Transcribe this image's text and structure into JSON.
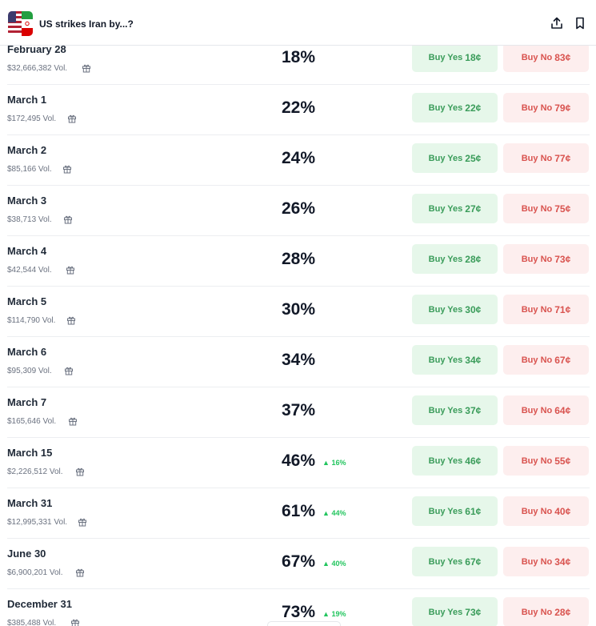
{
  "header": {
    "title": "US strikes Iran by...?",
    "share_icon": "share-icon",
    "bookmark_icon": "bookmark-icon"
  },
  "colors": {
    "yes_bg": "#e6f7ea",
    "yes_text": "#3a9c5a",
    "no_bg": "#fdeeee",
    "no_text": "#d9534f",
    "up": "#22c55e"
  },
  "labels": {
    "buy_yes": "Buy Yes",
    "buy_no": "Buy No"
  },
  "rows": [
    {
      "date": "February 28",
      "volume": "$32,666,382 Vol.",
      "chance": "18%",
      "change": "",
      "yes_price": "18¢",
      "no_price": "83¢"
    },
    {
      "date": "March 1",
      "volume": "$172,495 Vol.",
      "chance": "22%",
      "change": "",
      "yes_price": "22¢",
      "no_price": "79¢"
    },
    {
      "date": "March 2",
      "volume": "$85,166 Vol.",
      "chance": "24%",
      "change": "",
      "yes_price": "25¢",
      "no_price": "77¢"
    },
    {
      "date": "March 3",
      "volume": "$38,713 Vol.",
      "chance": "26%",
      "change": "",
      "yes_price": "27¢",
      "no_price": "75¢"
    },
    {
      "date": "March 4",
      "volume": "$42,544 Vol.",
      "chance": "28%",
      "change": "",
      "yes_price": "28¢",
      "no_price": "73¢"
    },
    {
      "date": "March 5",
      "volume": "$114,790 Vol.",
      "chance": "30%",
      "change": "",
      "yes_price": "30¢",
      "no_price": "71¢"
    },
    {
      "date": "March 6",
      "volume": "$95,309 Vol.",
      "chance": "34%",
      "change": "",
      "yes_price": "34¢",
      "no_price": "67¢"
    },
    {
      "date": "March 7",
      "volume": "$165,646 Vol.",
      "chance": "37%",
      "change": "",
      "yes_price": "37¢",
      "no_price": "64¢"
    },
    {
      "date": "March 15",
      "volume": "$2,226,512 Vol.",
      "chance": "46%",
      "change": "16%",
      "yes_price": "46¢",
      "no_price": "55¢"
    },
    {
      "date": "March 31",
      "volume": "$12,995,331 Vol.",
      "chance": "61%",
      "change": "44%",
      "yes_price": "61¢",
      "no_price": "40¢"
    },
    {
      "date": "June 30",
      "volume": "$6,900,201 Vol.",
      "chance": "67%",
      "change": "40%",
      "yes_price": "67¢",
      "no_price": "34¢"
    },
    {
      "date": "December 31",
      "volume": "$385,488 Vol.",
      "chance": "73%",
      "change": "19%",
      "yes_price": "73¢",
      "no_price": "28¢"
    }
  ]
}
